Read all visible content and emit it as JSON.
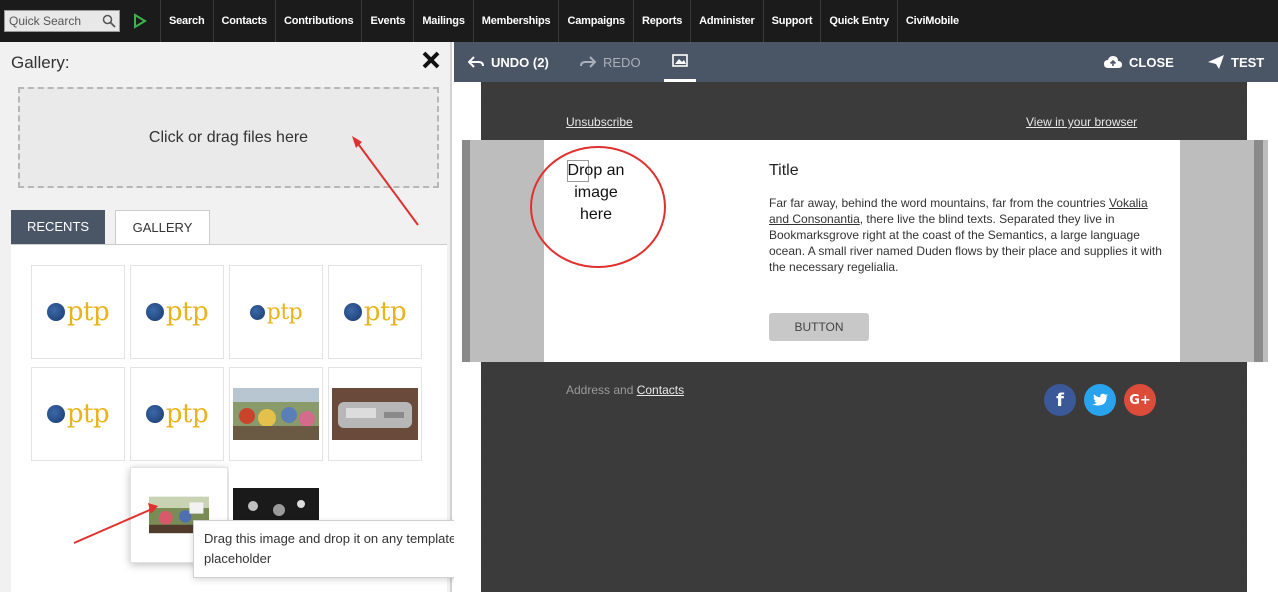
{
  "topbar": {
    "quick_search_placeholder": "Quick Search",
    "menu": [
      "Search",
      "Contacts",
      "Contributions",
      "Events",
      "Mailings",
      "Memberships",
      "Campaigns",
      "Reports",
      "Administer",
      "Support",
      "Quick Entry",
      "CiviMobile"
    ]
  },
  "gallery": {
    "title": "Gallery:",
    "dropzone_text": "Click or drag files here",
    "tabs": [
      "RECENTS",
      "GALLERY"
    ],
    "logo_text": "ptp",
    "tooltip": "Drag this image and drop it on any template image placeholder"
  },
  "editor": {
    "undo_label": "UNDO (2)",
    "redo_label": "REDO",
    "close_label": "CLOSE",
    "test_label": "TEST"
  },
  "template": {
    "unsubscribe": "Unsubscribe",
    "view_in_browser": "View in your browser",
    "drop_image_text": "Drop an image here",
    "title": "Title",
    "body_part1": "Far far away, behind the word mountains, far from the countries ",
    "body_link": "Vokalia and Consonantia",
    "body_part2": ", there live the blind texts. Separated they live in Bookmarksgrove right at the coast of the Semantics, a large language ocean. A small river named Duden flows by their place and supplies it with the necessary regelialia.",
    "button_label": "BUTTON",
    "footer_text": "Address and ",
    "footer_link": "Contacts"
  },
  "colors": {
    "menubar": "#1b1b1b",
    "toolbar": "#4a5566",
    "template_dark": "#3b3b3b",
    "logo_gold": "#e8b31b",
    "annotation_red": "#e03030"
  },
  "icons": {
    "search": "search-icon",
    "go": "play-arrow-icon",
    "close_gallery": "close-icon",
    "undo": "undo-icon",
    "redo": "redo-icon",
    "gallery_toggle": "image-icon",
    "close": "cloud-upload-icon",
    "test": "paper-plane-icon",
    "facebook": "facebook-icon",
    "twitter": "twitter-icon",
    "google_plus": "google-plus-icon"
  }
}
